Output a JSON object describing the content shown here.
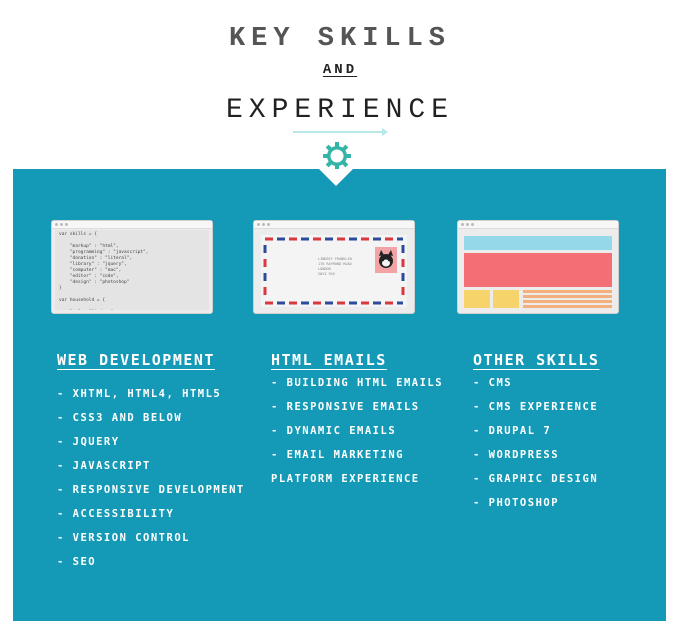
{
  "header": {
    "title_line1": "KEY SKILLS",
    "title_and": "AND",
    "title_line2": "EXPERIENCE"
  },
  "colors": {
    "panel": "#1499b6",
    "accent": "#35b5a7",
    "arrow": "#b6e8e6"
  },
  "icons": {
    "gear": "gear-icon",
    "arrow": "arrow-right-icon"
  },
  "columns": [
    {
      "title": "WEB DEVELOPMENT",
      "items": [
        "- XHTML, HTML4, HTML5",
        "- CSS3 AND BELOW",
        "- JQUERY",
        "- JAVASCRIPT",
        "- RESPONSIVE DEVELOPMENT",
        "- ACCESSIBILITY",
        "- VERSION CONTROL",
        "- SEO"
      ]
    },
    {
      "title": "HTML EMAILS",
      "items": [
        "- BUILDING HTML EMAILS",
        "- RESPONSIVE EMAILS",
        "- DYNAMIC EMAILS",
        "- EMAIL MARKETING",
        "PLATFORM EXPERIENCE"
      ]
    },
    {
      "title": "OTHER SKILLS",
      "items": [
        "- CMS",
        "- CMS EXPERIENCE",
        "- DRUPAL 7",
        "- WORDPRESS",
        "- GRAPHIC DESIGN",
        "- PHOTOSHOP"
      ]
    }
  ],
  "thumbnails": {
    "code_text": "var skills = {\n\n    \"markup\" : \"html\",\n    \"programming\" : \"javascript\",\n    \"donation\" : \"literal\",\n    \"library\" : \"jquery\",\n    \"computer\" : \"mac\",\n    \"editor\" : \"code\",\n    \"design\" : \"photoshop\"\n}\n\nvar household = {\n\n    \"me\" : \"lindsey\",",
    "envelope_address": "LINDSEY FRANKLIN\n178 RAYMOND ROAD\nLONDON\nSW13 9XX"
  }
}
